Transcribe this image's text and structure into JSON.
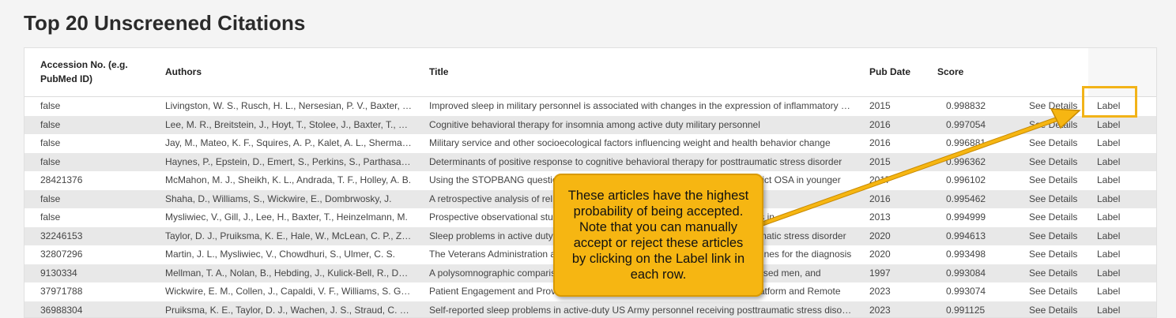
{
  "page": {
    "title": "Top 20 Unscreened Citations"
  },
  "table": {
    "headers": {
      "accession": "Accession No. (e.g. PubMed ID)",
      "authors": "Authors",
      "title": "Title",
      "pub_date": "Pub Date",
      "score": "Score"
    },
    "rows": [
      {
        "accession": "false",
        "authors": "Livingston, W. S., Rusch, H. L., Nersesian, P. V., Baxter, T., Mysliwiec, V.",
        "title": "Improved sleep in military personnel is associated with changes in the expression of inflammatory genes",
        "pub_date": "2015",
        "score": "0.998832",
        "details": "See Details",
        "label": "Label"
      },
      {
        "accession": "false",
        "authors": "Lee, M. R., Breitstein, J., Hoyt, T., Stolee, J., Baxter, T., Kwon, H.",
        "title": "Cognitive behavioral therapy for insomnia among active duty military personnel",
        "pub_date": "2016",
        "score": "0.997054",
        "details": "See Details",
        "label": "Label"
      },
      {
        "accession": "false",
        "authors": "Jay, M., Mateo, K. F., Squires, A. P., Kalet, A. L., Sherman, S. E.",
        "title": "Military service and other socioecological factors influencing weight and health behavior change",
        "pub_date": "2016",
        "score": "0.996881",
        "details": "See Details",
        "label": "Label"
      },
      {
        "accession": "false",
        "authors": "Haynes, P., Epstein, D., Emert, S., Perkins, S., Parthasarathy, S.",
        "title": "Determinants of positive response to cognitive behavioral therapy for posttraumatic stress disorder",
        "pub_date": "2015",
        "score": "0.996362",
        "details": "See Details",
        "label": "Label"
      },
      {
        "accession": "28421376",
        "authors": "McMahon, M. J., Sheikh, K. L., Andrada, T. F., Holley, A. B.",
        "title": "Using the STOPBANG questionnaire and other pre-test probability tools to predict OSA in younger",
        "pub_date": "2017",
        "score": "0.996102",
        "details": "See Details",
        "label": "Label"
      },
      {
        "accession": "false",
        "authors": "Shaha, D., Williams, S., Wickwire, E., Dombrwosky, J.",
        "title": "A retrospective analysis of reliability and validity of online cognitive",
        "pub_date": "2016",
        "score": "0.995462",
        "details": "See Details",
        "label": "Label"
      },
      {
        "accession": "false",
        "authors": "Mysliwiec, V., Gill, J., Lee, H., Baxter, T., Heinzelmann, M.",
        "title": "Prospective observational study of sleep disturbance and inflammatory changes in",
        "pub_date": "2013",
        "score": "0.994999",
        "details": "See Details",
        "label": "Label"
      },
      {
        "accession": "32246153",
        "authors": "Taylor, D. J., Pruiksma, K. E., Hale, W., McLean, C. P., Zandberg, L. J.",
        "title": "Sleep problems in active duty military personnel seeking treatment for posttraumatic stress disorder",
        "pub_date": "2020",
        "score": "0.994613",
        "details": "See Details",
        "label": "Label"
      },
      {
        "accession": "32807296",
        "authors": "Martin, J. L., Mysliwiec, V., Chowdhuri, S., Ulmer, C. S.",
        "title": "The Veterans Administration and Department of Defense clinical practice guidelines for the diagnosis",
        "pub_date": "2020",
        "score": "0.993498",
        "details": "See Details",
        "label": "Label"
      },
      {
        "accession": "9130334",
        "authors": "Mellman, T. A., Nolan, B., Hebding, J., Kulick-Bell, R., Dominguez, R.",
        "title": "A polysomnographic comparison of veterans with combat-related PTSD, depressed men, and",
        "pub_date": "1997",
        "score": "0.993084",
        "details": "See Details",
        "label": "Label"
      },
      {
        "accession": "37971788",
        "authors": "Wickwire, E. M., Collen, J., Capaldi, V. F., Williams, S. G., Albrecht, J. S.",
        "title": "Patient Engagement and Provider Effectiveness of a Novel Sleep Telehealth Platform and Remote",
        "pub_date": "2023",
        "score": "0.993074",
        "details": "See Details",
        "label": "Label"
      },
      {
        "accession": "36988304",
        "authors": "Pruiksma, K. E., Taylor, D. J., Wachen, J. S., Straud, C. L., Hale, W. J.",
        "title": "Self-reported sleep problems in active-duty US Army personnel receiving posttraumatic stress disorder",
        "pub_date": "2023",
        "score": "0.991125",
        "details": "See Details",
        "label": "Label"
      }
    ]
  },
  "callout": {
    "text": "These articles have the highest probability of being accepted. Note that you can manually accept or reject these articles by clicking on the Label link in each row.",
    "color": "#f6b612"
  }
}
